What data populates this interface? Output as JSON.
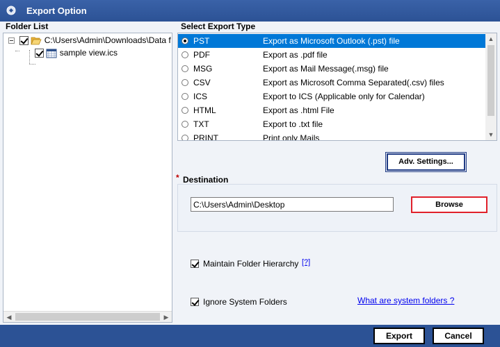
{
  "window": {
    "title": "Export Option"
  },
  "folder_list": {
    "label": "Folder List",
    "root": {
      "path": "C:\\Users\\Admin\\Downloads\\Data f",
      "checked": true
    },
    "children": [
      {
        "name": "sample view.ics",
        "checked": true
      }
    ]
  },
  "export_type": {
    "label": "Select Export Type",
    "options": [
      {
        "name": "PST",
        "desc": "Export as Microsoft Outlook (.pst) file",
        "selected": true
      },
      {
        "name": "PDF",
        "desc": "Export as .pdf file",
        "selected": false
      },
      {
        "name": "MSG",
        "desc": "Export as Mail Message(.msg) file",
        "selected": false
      },
      {
        "name": "CSV",
        "desc": "Export as Microsoft Comma Separated(.csv) files",
        "selected": false
      },
      {
        "name": "ICS",
        "desc": "Export to ICS (Applicable only for Calendar)",
        "selected": false
      },
      {
        "name": "HTML",
        "desc": "Export as .html File",
        "selected": false
      },
      {
        "name": "TXT",
        "desc": "Export to .txt file",
        "selected": false
      },
      {
        "name": "PRINT",
        "desc": "Print only Mails",
        "selected": false
      }
    ],
    "adv_settings_label": "Adv. Settings..."
  },
  "destination": {
    "required_marker": "*",
    "label": "Destination",
    "path": "C:\\Users\\Admin\\Desktop",
    "browse_label": "Browse"
  },
  "options": {
    "maintain_hierarchy": {
      "label": "Maintain Folder Hierarchy",
      "checked": true,
      "help": "[?]"
    },
    "ignore_system": {
      "label": "Ignore System Folders",
      "checked": true,
      "link": "What are system folders ?"
    }
  },
  "footer": {
    "export_label": "Export",
    "cancel_label": "Cancel"
  },
  "colors": {
    "titlebar": "#2c5295",
    "selection": "#0078d7",
    "browse_border": "#e0202a"
  }
}
